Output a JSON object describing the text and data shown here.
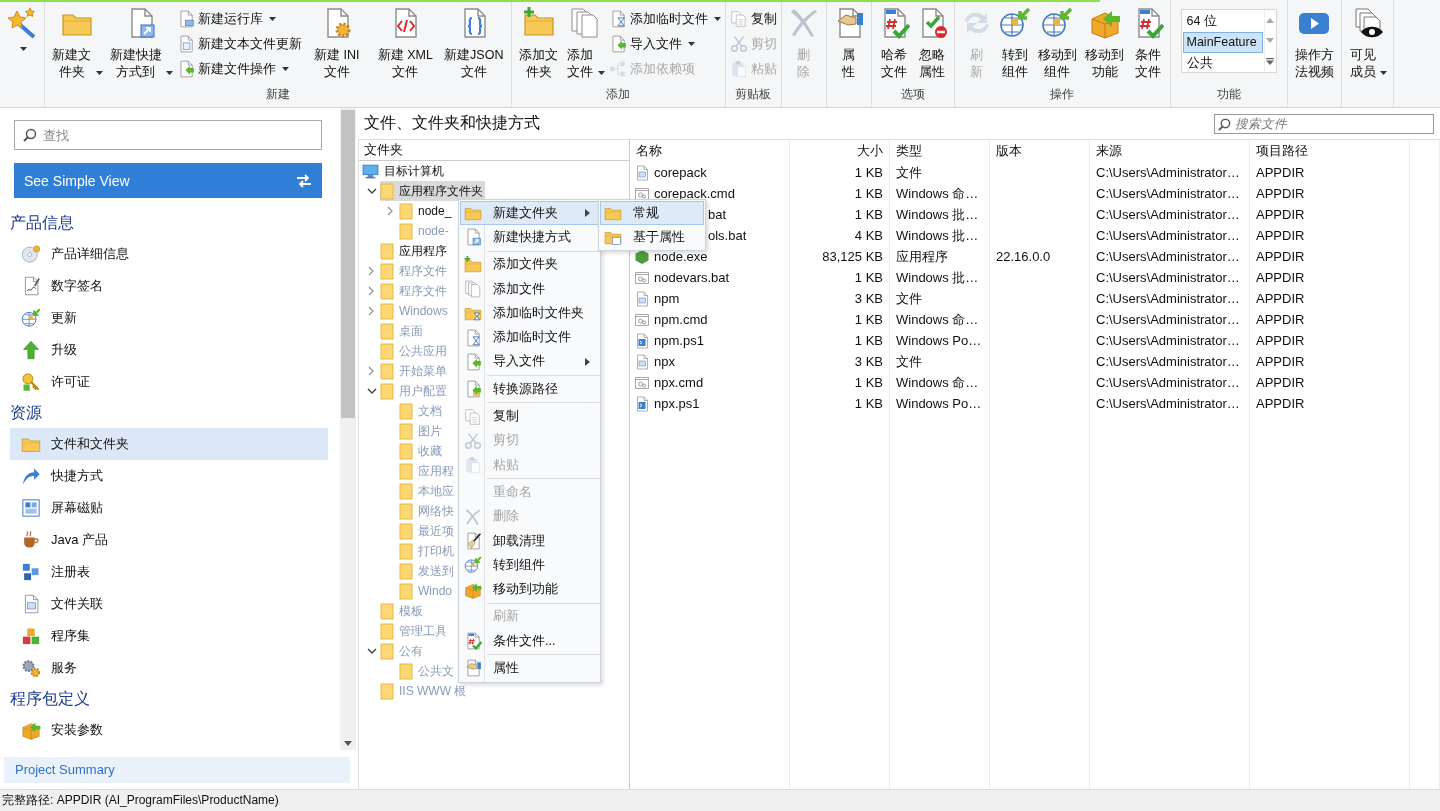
{
  "ribbon": {
    "groups": [
      {
        "buttons": [
          {
            "kind": "large",
            "dropdown": true,
            "disabled": false
          }
        ]
      },
      {
        "label": "新建",
        "buttons": [
          {
            "kind": "large",
            "label": "新建文件夹",
            "dropdown": true,
            "disabled": false
          },
          {
            "kind": "large",
            "label": "新建快捷方式到",
            "dropdown": true,
            "disabled": false
          },
          {
            "kind": "small",
            "label": "新建运行库",
            "dropdown": true,
            "disabled": false
          },
          {
            "kind": "small",
            "label": "新建文本文件更新",
            "dropdown": false,
            "disabled": false
          },
          {
            "kind": "small",
            "label": "新建文件操作",
            "dropdown": true,
            "disabled": false
          },
          {
            "kind": "large",
            "label": "新建 INI 文件",
            "dropdown": false,
            "disabled": false
          },
          {
            "kind": "large",
            "label": "新建 XML 文件",
            "dropdown": false,
            "disabled": false
          },
          {
            "kind": "large",
            "label": "新建JSON 文件",
            "dropdown": false,
            "disabled": false
          }
        ]
      },
      {
        "label": "添加",
        "buttons": [
          {
            "kind": "large",
            "label": "添加文件夹",
            "dropdown": false,
            "disabled": false
          },
          {
            "kind": "large",
            "label": "添加文件",
            "dropdown": true,
            "disabled": false
          },
          {
            "kind": "small",
            "label": "添加临时文件",
            "dropdown": true,
            "disabled": false
          },
          {
            "kind": "small",
            "label": "导入文件",
            "dropdown": true,
            "disabled": false
          },
          {
            "kind": "small",
            "label": "添加依赖项",
            "dropdown": false,
            "disabled": true
          }
        ]
      },
      {
        "label": "剪贴板",
        "buttons": [
          {
            "kind": "small",
            "label": "复制",
            "dropdown": false,
            "disabled": false
          },
          {
            "kind": "small",
            "label": "剪切",
            "dropdown": false,
            "disabled": true
          },
          {
            "kind": "small",
            "label": "粘贴",
            "dropdown": false,
            "disabled": true
          }
        ]
      },
      {
        "buttons": [
          {
            "kind": "large",
            "label": "删除",
            "dropdown": false,
            "disabled": true
          }
        ]
      },
      {
        "buttons": [
          {
            "kind": "large",
            "label": "属性",
            "dropdown": false,
            "disabled": false
          }
        ]
      },
      {
        "label": "选项",
        "buttons": [
          {
            "kind": "large",
            "label": "哈希文件",
            "dropdown": false,
            "disabled": false
          },
          {
            "kind": "large",
            "label": "忽略属性",
            "dropdown": false,
            "disabled": false
          }
        ]
      },
      {
        "label": "操作",
        "buttons": [
          {
            "kind": "large",
            "label": "刷新",
            "dropdown": false,
            "disabled": true
          },
          {
            "kind": "large",
            "label": "转到组件",
            "dropdown": false,
            "disabled": false
          },
          {
            "kind": "large",
            "label": "移动到组件",
            "dropdown": false,
            "disabled": false
          },
          {
            "kind": "large",
            "label": "移动到功能",
            "dropdown": false,
            "disabled": false
          },
          {
            "kind": "large",
            "label": "条件文件",
            "dropdown": false,
            "disabled": false
          }
        ]
      },
      {
        "label": "功能",
        "buttons": [
          {
            "kind": "list",
            "items": [
              {
                "label": "64 位",
                "selected": false
              },
              {
                "label": "MainFeature",
                "selected": true
              },
              {
                "label": "公共",
                "selected": false
              }
            ]
          }
        ]
      },
      {
        "buttons": [
          {
            "kind": "large",
            "label": "操作方法视频",
            "dropdown": false,
            "disabled": false
          }
        ]
      },
      {
        "buttons": [
          {
            "kind": "large",
            "label": "可见成员",
            "dropdown": true,
            "disabled": false
          }
        ]
      }
    ]
  },
  "sidebar": {
    "search_placeholder": "查找",
    "simple_view_button": "See Simple View",
    "sections": [
      {
        "title": "产品信息",
        "items": [
          {
            "label": "产品详细信息",
            "selected": false
          },
          {
            "label": "数字签名",
            "selected": false
          },
          {
            "label": "更新",
            "selected": false
          },
          {
            "label": "升级",
            "selected": false
          },
          {
            "label": "许可证",
            "selected": false
          }
        ]
      },
      {
        "title": "资源",
        "items": [
          {
            "label": "文件和文件夹",
            "selected": true
          },
          {
            "label": "快捷方式",
            "selected": false
          },
          {
            "label": "屏幕磁贴",
            "selected": false
          },
          {
            "label": "Java 产品",
            "selected": false
          },
          {
            "label": "注册表",
            "selected": false
          },
          {
            "label": "文件关联",
            "selected": false
          },
          {
            "label": "程序集",
            "selected": false
          },
          {
            "label": "服务",
            "selected": false
          }
        ]
      },
      {
        "title": "程序包定义",
        "items": [
          {
            "label": "安装参数",
            "selected": false
          }
        ]
      }
    ],
    "footer": "Project Summary"
  },
  "page_title": "文件、文件夹和快捷方式",
  "file_search_placeholder": "搜索文件",
  "folders": {
    "header": "文件夹",
    "tree": [
      {
        "kind": "computer",
        "label": "目标计算机",
        "selected": false,
        "greyed": false,
        "children": [
          {
            "kind": "branch",
            "label": "应用程序文件夹",
            "expanded": true,
            "selected": true,
            "greyed": false,
            "children": [
              {
                "kind": "branch",
                "label": "node_",
                "expanded": false,
                "selected": false,
                "greyed": false
              },
              {
                "kind": "folder",
                "label": "node-",
                "selected": false,
                "greyed": true
              }
            ]
          },
          {
            "kind": "folder",
            "label": "应用程序",
            "selected": false,
            "greyed": false
          },
          {
            "kind": "branch",
            "label": "程序文件",
            "expanded": false,
            "selected": false,
            "greyed": true
          },
          {
            "kind": "branch",
            "label": "程序文件",
            "expanded": false,
            "selected": false,
            "greyed": true
          },
          {
            "kind": "branch",
            "label": "Windows",
            "expanded": false,
            "selected": false,
            "greyed": true
          },
          {
            "kind": "folder",
            "label": "桌面",
            "selected": false,
            "greyed": true
          },
          {
            "kind": "folder",
            "label": "公共应用",
            "selected": false,
            "greyed": true
          },
          {
            "kind": "branch",
            "label": "开始菜单",
            "expanded": false,
            "selected": false,
            "greyed": true
          },
          {
            "kind": "branch",
            "label": "用户配置",
            "expanded": true,
            "selected": false,
            "greyed": true,
            "children": [
              {
                "kind": "folder",
                "label": "文档",
                "selected": false,
                "greyed": true
              },
              {
                "kind": "folder",
                "label": "图片",
                "selected": false,
                "greyed": true
              },
              {
                "kind": "folder",
                "label": "收藏",
                "selected": false,
                "greyed": true
              },
              {
                "kind": "folder",
                "label": "应用程",
                "selected": false,
                "greyed": true
              },
              {
                "kind": "folder",
                "label": "本地应",
                "selected": false,
                "greyed": true
              },
              {
                "kind": "folder",
                "label": "网络快",
                "selected": false,
                "greyed": true
              },
              {
                "kind": "folder",
                "label": "最近项",
                "selected": false,
                "greyed": true
              },
              {
                "kind": "folder",
                "label": "打印机",
                "selected": false,
                "greyed": true
              },
              {
                "kind": "folder",
                "label": "发送到",
                "selected": false,
                "greyed": true
              },
              {
                "kind": "folder",
                "label": "Windo",
                "selected": false,
                "greyed": true
              }
            ]
          },
          {
            "kind": "folder",
            "label": "模板",
            "selected": false,
            "greyed": true
          },
          {
            "kind": "folder",
            "label": "管理工具",
            "selected": false,
            "greyed": true
          },
          {
            "kind": "branch",
            "label": "公有",
            "expanded": true,
            "selected": false,
            "greyed": true,
            "children": [
              {
                "kind": "folder",
                "label": "公共文",
                "selected": false,
                "greyed": true
              }
            ]
          },
          {
            "kind": "folder",
            "label": "IIS WWW 根",
            "selected": false,
            "greyed": true
          }
        ]
      }
    ]
  },
  "file_list": {
    "columns": [
      "名称",
      "大小",
      "类型",
      "版本",
      "来源",
      "项目路径"
    ],
    "rows": [
      {
        "kind": "plain",
        "covered": false,
        "cells": [
          "corepack",
          "1 KB",
          "文件",
          "",
          "C:\\Users\\Administrator…",
          "APPDIR"
        ]
      },
      {
        "kind": "script",
        "covered": false,
        "cells": [
          "corepack.cmd",
          "1 KB",
          "Windows 命…",
          "",
          "C:\\Users\\Administrator…",
          "APPDIR"
        ]
      },
      {
        "covered": true,
        "cells": [
          "bat",
          "1 KB",
          "Windows 批…",
          "",
          "C:\\Users\\Administrator…",
          "APPDIR"
        ]
      },
      {
        "covered": true,
        "cells": [
          "ols.bat",
          "4 KB",
          "Windows 批…",
          "",
          "C:\\Users\\Administrator…",
          "APPDIR"
        ]
      },
      {
        "kind": "exe",
        "covered": false,
        "cells": [
          "node.exe",
          "83,125 KB",
          "应用程序",
          "22.16.0.0",
          "C:\\Users\\Administrator…",
          "APPDIR"
        ]
      },
      {
        "kind": "script",
        "covered": false,
        "cells": [
          "nodevars.bat",
          "1 KB",
          "Windows 批…",
          "",
          "C:\\Users\\Administrator…",
          "APPDIR"
        ]
      },
      {
        "kind": "plain",
        "covered": false,
        "cells": [
          "npm",
          "3 KB",
          "文件",
          "",
          "C:\\Users\\Administrator…",
          "APPDIR"
        ]
      },
      {
        "kind": "script",
        "covered": false,
        "cells": [
          "npm.cmd",
          "1 KB",
          "Windows 命…",
          "",
          "C:\\Users\\Administrator…",
          "APPDIR"
        ]
      },
      {
        "kind": "powershell",
        "covered": false,
        "cells": [
          "npm.ps1",
          "1 KB",
          "Windows Po…",
          "",
          "C:\\Users\\Administrator…",
          "APPDIR"
        ]
      },
      {
        "kind": "plain",
        "covered": false,
        "cells": [
          "npx",
          "3 KB",
          "文件",
          "",
          "C:\\Users\\Administrator…",
          "APPDIR"
        ]
      },
      {
        "kind": "script",
        "covered": false,
        "cells": [
          "npx.cmd",
          "1 KB",
          "Windows 命…",
          "",
          "C:\\Users\\Administrator…",
          "APPDIR"
        ]
      },
      {
        "kind": "powershell",
        "covered": false,
        "cells": [
          "npx.ps1",
          "1 KB",
          "Windows Po…",
          "",
          "C:\\Users\\Administrator…",
          "APPDIR"
        ]
      }
    ]
  },
  "context_menu": {
    "groups": [
      {
        "items": [
          {
            "label": "新建文件夹",
            "submenu": true,
            "selected": true,
            "disabled": false
          },
          {
            "label": "新建快捷方式",
            "submenu": false,
            "selected": false,
            "disabled": false
          }
        ]
      },
      {
        "items": [
          {
            "label": "添加文件夹",
            "submenu": false,
            "selected": false,
            "disabled": false
          },
          {
            "label": "添加文件",
            "submenu": false,
            "selected": false,
            "disabled": false
          },
          {
            "label": "添加临时文件夹",
            "submenu": false,
            "selected": false,
            "disabled": false
          },
          {
            "label": "添加临时文件",
            "submenu": false,
            "selected": false,
            "disabled": false
          },
          {
            "label": "导入文件",
            "submenu": true,
            "selected": false,
            "disabled": false
          }
        ]
      },
      {
        "items": [
          {
            "label": "转换源路径",
            "submenu": false,
            "selected": false,
            "disabled": false
          }
        ]
      },
      {
        "items": [
          {
            "label": "复制",
            "submenu": false,
            "selected": false,
            "disabled": false
          },
          {
            "label": "剪切",
            "submenu": false,
            "selected": false,
            "disabled": true
          },
          {
            "label": "粘贴",
            "submenu": false,
            "selected": false,
            "disabled": true
          }
        ]
      },
      {
        "items": [
          {
            "label": "重命名",
            "submenu": false,
            "selected": false,
            "disabled": true
          },
          {
            "label": "删除",
            "submenu": false,
            "selected": false,
            "disabled": true
          },
          {
            "label": "卸载清理",
            "submenu": false,
            "selected": false,
            "disabled": false
          },
          {
            "label": "转到组件",
            "submenu": false,
            "selected": false,
            "disabled": false
          },
          {
            "label": "移动到功能",
            "submenu": false,
            "selected": false,
            "disabled": false
          }
        ]
      },
      {
        "items": [
          {
            "label": "刷新",
            "submenu": false,
            "selected": false,
            "disabled": true
          },
          {
            "label": "条件文件...",
            "submenu": false,
            "selected": false,
            "disabled": false
          }
        ]
      },
      {
        "items": [
          {
            "label": "属性",
            "submenu": false,
            "selected": false,
            "disabled": false
          }
        ]
      }
    ]
  },
  "submenu": {
    "items": [
      {
        "label": "常规",
        "selected": true
      },
      {
        "label": "基于属性",
        "selected": false
      }
    ]
  },
  "status_bar": "完整路径: APPDIR (AI_ProgramFiles\\ProductName)"
}
